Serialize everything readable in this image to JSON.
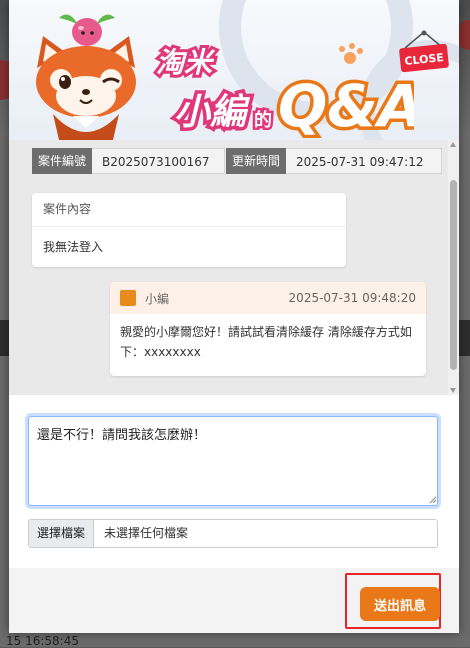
{
  "background": {
    "timestamp_fragment": "15 16:58:45"
  },
  "banner": {
    "logo_line1": "淘米",
    "logo_line2": "小編",
    "logo_small": "的",
    "logo_qa": "Q&A",
    "close_label": "CLOSE"
  },
  "case": {
    "number_label": "案件編號",
    "number_value": "B2025073100167",
    "updated_label": "更新時間",
    "updated_value": "2025-07-31 09:47:12"
  },
  "content_card": {
    "title": "案件內容",
    "body": "我無法登入"
  },
  "reply": {
    "sender": "小編",
    "time": "2025-07-31 09:48:20",
    "body": "親愛的小摩爾您好！請試試看清除緩存 清除緩存方式如下：xxxxxxxx"
  },
  "compose": {
    "message_value": "還是不行！請問我該怎麼辦！",
    "file_button": "選擇檔案",
    "file_name": "未選擇任何檔案",
    "send_label": "送出訊息"
  },
  "colors": {
    "accent_orange": "#e97818",
    "highlight_red": "#e8232a",
    "focus_blue": "#86b7fe"
  }
}
